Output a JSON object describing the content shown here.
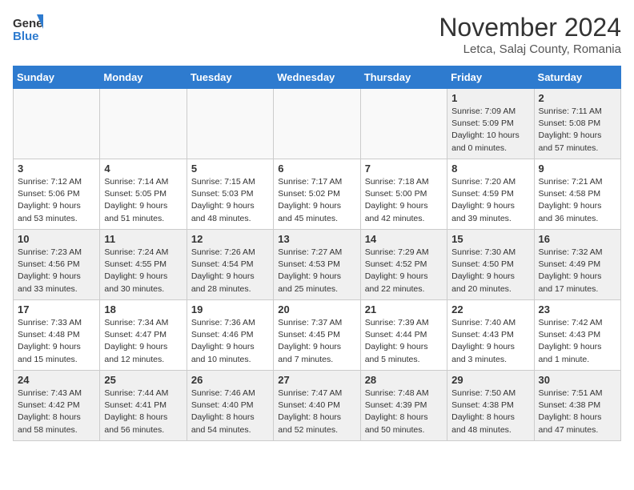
{
  "header": {
    "logo_general": "General",
    "logo_blue": "Blue",
    "title": "November 2024",
    "subtitle": "Letca, Salaj County, Romania"
  },
  "weekdays": [
    "Sunday",
    "Monday",
    "Tuesday",
    "Wednesday",
    "Thursday",
    "Friday",
    "Saturday"
  ],
  "weeks": [
    [
      {
        "day": "",
        "info": "",
        "empty": true
      },
      {
        "day": "",
        "info": "",
        "empty": true
      },
      {
        "day": "",
        "info": "",
        "empty": true
      },
      {
        "day": "",
        "info": "",
        "empty": true
      },
      {
        "day": "",
        "info": "",
        "empty": true
      },
      {
        "day": "1",
        "info": "Sunrise: 7:09 AM\nSunset: 5:09 PM\nDaylight: 10 hours\nand 0 minutes."
      },
      {
        "day": "2",
        "info": "Sunrise: 7:11 AM\nSunset: 5:08 PM\nDaylight: 9 hours\nand 57 minutes."
      }
    ],
    [
      {
        "day": "3",
        "info": "Sunrise: 7:12 AM\nSunset: 5:06 PM\nDaylight: 9 hours\nand 53 minutes."
      },
      {
        "day": "4",
        "info": "Sunrise: 7:14 AM\nSunset: 5:05 PM\nDaylight: 9 hours\nand 51 minutes."
      },
      {
        "day": "5",
        "info": "Sunrise: 7:15 AM\nSunset: 5:03 PM\nDaylight: 9 hours\nand 48 minutes."
      },
      {
        "day": "6",
        "info": "Sunrise: 7:17 AM\nSunset: 5:02 PM\nDaylight: 9 hours\nand 45 minutes."
      },
      {
        "day": "7",
        "info": "Sunrise: 7:18 AM\nSunset: 5:00 PM\nDaylight: 9 hours\nand 42 minutes."
      },
      {
        "day": "8",
        "info": "Sunrise: 7:20 AM\nSunset: 4:59 PM\nDaylight: 9 hours\nand 39 minutes."
      },
      {
        "day": "9",
        "info": "Sunrise: 7:21 AM\nSunset: 4:58 PM\nDaylight: 9 hours\nand 36 minutes."
      }
    ],
    [
      {
        "day": "10",
        "info": "Sunrise: 7:23 AM\nSunset: 4:56 PM\nDaylight: 9 hours\nand 33 minutes."
      },
      {
        "day": "11",
        "info": "Sunrise: 7:24 AM\nSunset: 4:55 PM\nDaylight: 9 hours\nand 30 minutes."
      },
      {
        "day": "12",
        "info": "Sunrise: 7:26 AM\nSunset: 4:54 PM\nDaylight: 9 hours\nand 28 minutes."
      },
      {
        "day": "13",
        "info": "Sunrise: 7:27 AM\nSunset: 4:53 PM\nDaylight: 9 hours\nand 25 minutes."
      },
      {
        "day": "14",
        "info": "Sunrise: 7:29 AM\nSunset: 4:52 PM\nDaylight: 9 hours\nand 22 minutes."
      },
      {
        "day": "15",
        "info": "Sunrise: 7:30 AM\nSunset: 4:50 PM\nDaylight: 9 hours\nand 20 minutes."
      },
      {
        "day": "16",
        "info": "Sunrise: 7:32 AM\nSunset: 4:49 PM\nDaylight: 9 hours\nand 17 minutes."
      }
    ],
    [
      {
        "day": "17",
        "info": "Sunrise: 7:33 AM\nSunset: 4:48 PM\nDaylight: 9 hours\nand 15 minutes."
      },
      {
        "day": "18",
        "info": "Sunrise: 7:34 AM\nSunset: 4:47 PM\nDaylight: 9 hours\nand 12 minutes."
      },
      {
        "day": "19",
        "info": "Sunrise: 7:36 AM\nSunset: 4:46 PM\nDaylight: 9 hours\nand 10 minutes."
      },
      {
        "day": "20",
        "info": "Sunrise: 7:37 AM\nSunset: 4:45 PM\nDaylight: 9 hours\nand 7 minutes."
      },
      {
        "day": "21",
        "info": "Sunrise: 7:39 AM\nSunset: 4:44 PM\nDaylight: 9 hours\nand 5 minutes."
      },
      {
        "day": "22",
        "info": "Sunrise: 7:40 AM\nSunset: 4:43 PM\nDaylight: 9 hours\nand 3 minutes."
      },
      {
        "day": "23",
        "info": "Sunrise: 7:42 AM\nSunset: 4:43 PM\nDaylight: 9 hours\nand 1 minute."
      }
    ],
    [
      {
        "day": "24",
        "info": "Sunrise: 7:43 AM\nSunset: 4:42 PM\nDaylight: 8 hours\nand 58 minutes."
      },
      {
        "day": "25",
        "info": "Sunrise: 7:44 AM\nSunset: 4:41 PM\nDaylight: 8 hours\nand 56 minutes."
      },
      {
        "day": "26",
        "info": "Sunrise: 7:46 AM\nSunset: 4:40 PM\nDaylight: 8 hours\nand 54 minutes."
      },
      {
        "day": "27",
        "info": "Sunrise: 7:47 AM\nSunset: 4:40 PM\nDaylight: 8 hours\nand 52 minutes."
      },
      {
        "day": "28",
        "info": "Sunrise: 7:48 AM\nSunset: 4:39 PM\nDaylight: 8 hours\nand 50 minutes."
      },
      {
        "day": "29",
        "info": "Sunrise: 7:50 AM\nSunset: 4:38 PM\nDaylight: 8 hours\nand 48 minutes."
      },
      {
        "day": "30",
        "info": "Sunrise: 7:51 AM\nSunset: 4:38 PM\nDaylight: 8 hours\nand 47 minutes."
      }
    ]
  ]
}
